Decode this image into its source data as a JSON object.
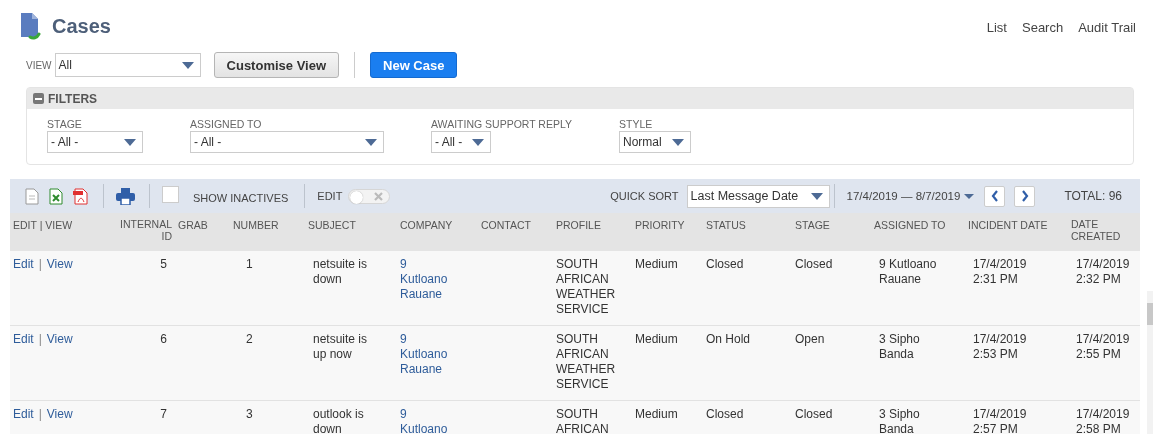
{
  "page": {
    "title": "Cases",
    "links": [
      "List",
      "Search",
      "Audit Trail"
    ]
  },
  "view": {
    "label": "VIEW",
    "value": "All"
  },
  "buttons": [
    {
      "label": "Customise View",
      "kind": "secondary"
    },
    {
      "label": "New Case",
      "kind": "primary"
    }
  ],
  "filters": {
    "title": "FILTERS",
    "expanded": true,
    "fields": [
      {
        "label": "STAGE",
        "value": "- All -"
      },
      {
        "label": "ASSIGNED TO",
        "value": "- All -"
      },
      {
        "label": "AWAITING SUPPORT REPLY",
        "value": "- All -"
      },
      {
        "label": "STYLE",
        "value": "Normal"
      }
    ]
  },
  "toolbar": {
    "show_inactives": {
      "label": "SHOW INACTIVES",
      "checked": false
    },
    "edit": {
      "label": "EDIT",
      "on": false
    },
    "quick_sort": {
      "label": "QUICK SORT",
      "value": "Last Message Date"
    },
    "date_range": "17/4/2019 — 8/7/2019",
    "total": "TOTAL: 96"
  },
  "table": {
    "columns": [
      "EDIT | VIEW",
      "INTERNAL ID",
      "GRAB",
      "NUMBER",
      "SUBJECT",
      "COMPANY",
      "CONTACT",
      "PROFILE",
      "PRIORITY",
      "STATUS",
      "STAGE",
      "ASSIGNED TO",
      "INCIDENT DATE",
      "DATE CREATED"
    ],
    "rows": [
      {
        "edit": "Edit",
        "separator": "|",
        "view": "View",
        "internal_id": "5",
        "number": "1",
        "subject": "netsuite is down",
        "company": "9 Kutloano Rauane",
        "profile": "SOUTH AFRICAN WEATHER SERVICE",
        "priority": "Medium",
        "status": "Closed",
        "stage": "Closed",
        "assigned_to": "9 Kutloano Rauane",
        "incident_date": "17/4/2019 2:31 PM",
        "date_created": "17/4/2019 2:32 PM"
      },
      {
        "edit": "Edit",
        "separator": "|",
        "view": "View",
        "internal_id": "6",
        "number": "2",
        "subject": "netsuite is up now",
        "company": "9 Kutloano Rauane",
        "profile": "SOUTH AFRICAN WEATHER SERVICE",
        "priority": "Medium",
        "status": "On Hold",
        "stage": "Open",
        "assigned_to": "3 Sipho Banda",
        "incident_date": "17/4/2019 2:53 PM",
        "date_created": "17/4/2019 2:55 PM"
      },
      {
        "edit": "Edit",
        "separator": "|",
        "view": "View",
        "internal_id": "7",
        "number": "3",
        "subject": "outlook is down",
        "company": "9 Kutloano",
        "profile": "SOUTH AFRICAN",
        "priority": "Medium",
        "status": "Closed",
        "stage": "Closed",
        "assigned_to": "3 Sipho Banda",
        "incident_date": "17/4/2019 2:57 PM",
        "date_created": "17/4/2019 2:58 PM"
      }
    ]
  }
}
